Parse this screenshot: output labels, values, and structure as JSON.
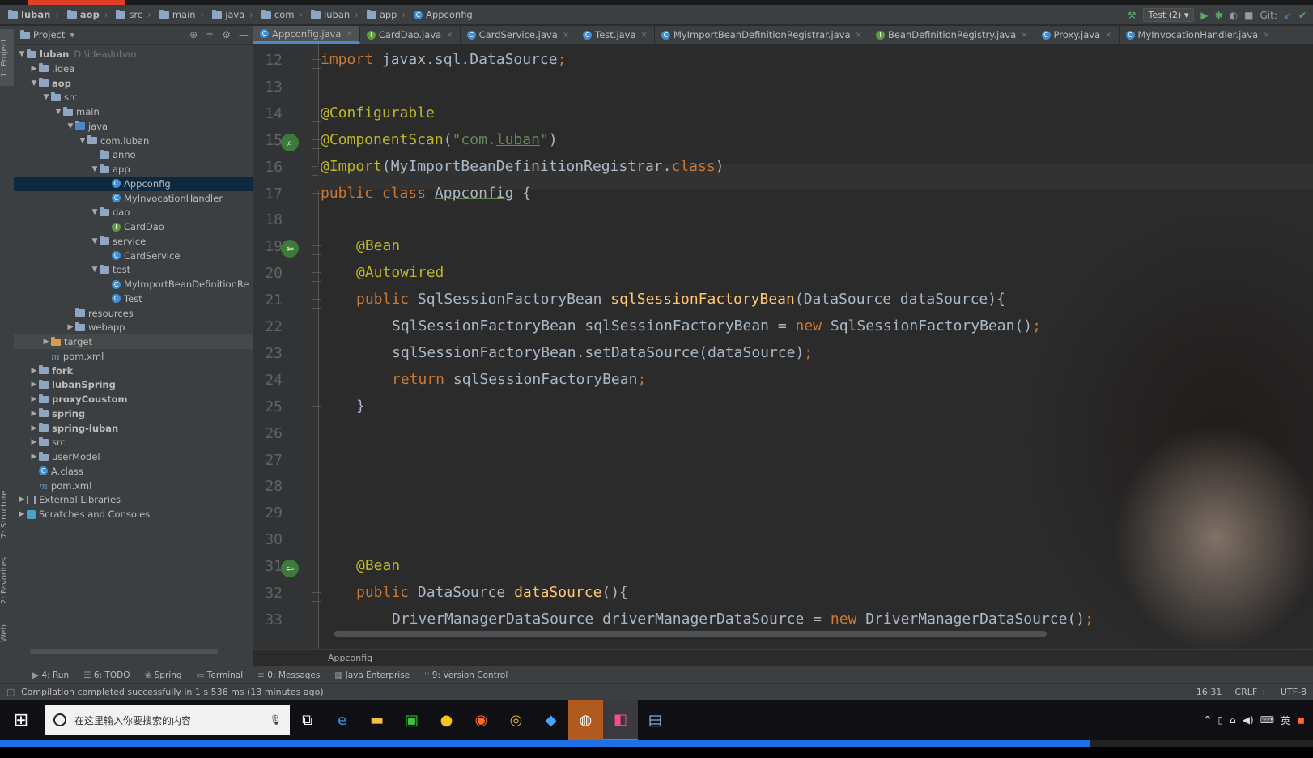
{
  "navbar": {
    "crumbs": [
      "luban",
      "aop",
      "src",
      "main",
      "java",
      "com",
      "luban",
      "app",
      "Appconfig"
    ],
    "run_config": "Test (2)",
    "vcs_label": "Git:"
  },
  "tool_windows_left": [
    "1: Project",
    "7: Structure",
    "2: Favorites",
    "Web"
  ],
  "project": {
    "header": "Project",
    "rows": [
      {
        "label": "luban",
        "path": "D:\\idea\\luban"
      },
      {
        "label": ".idea"
      },
      {
        "label": "aop"
      },
      {
        "label": "src"
      },
      {
        "label": "main"
      },
      {
        "label": "java"
      },
      {
        "label": "com.luban"
      },
      {
        "label": "anno"
      },
      {
        "label": "app"
      },
      {
        "label": "Appconfig"
      },
      {
        "label": "MyInvocationHandler"
      },
      {
        "label": "dao"
      },
      {
        "label": "CardDao"
      },
      {
        "label": "service"
      },
      {
        "label": "CardService"
      },
      {
        "label": "test"
      },
      {
        "label": "MyImportBeanDefinitionRe"
      },
      {
        "label": "Test"
      },
      {
        "label": "resources"
      },
      {
        "label": "webapp"
      },
      {
        "label": "target"
      },
      {
        "label": "pom.xml"
      },
      {
        "label": "fork"
      },
      {
        "label": "lubanSpring"
      },
      {
        "label": "proxyCoustom"
      },
      {
        "label": "spring"
      },
      {
        "label": "spring-luban"
      },
      {
        "label": "src"
      },
      {
        "label": "userModel"
      },
      {
        "label": "A.class"
      },
      {
        "label": "pom.xml"
      },
      {
        "label": "External Libraries"
      },
      {
        "label": "Scratches and Consoles"
      }
    ]
  },
  "tabs": [
    "Appconfig.java",
    "CardDao.java",
    "CardService.java",
    "Test.java",
    "MyImportBeanDefinitionRegistrar.java",
    "BeanDefinitionRegistry.java",
    "Proxy.java",
    "MyInvocationHandler.java"
  ],
  "editor": {
    "line_numbers": [
      "12",
      "13",
      "14",
      "15",
      "16",
      "17",
      "18",
      "19",
      "20",
      "21",
      "22",
      "23",
      "24",
      "25",
      "26",
      "27",
      "28",
      "29",
      "30",
      "31",
      "32",
      "33"
    ],
    "breadcrumb": "Appconfig",
    "code": {
      "l12a": "import",
      "l12b": " javax.sql.DataSource",
      "l12c": ";",
      "l14": "@Configurable",
      "l15a": "@ComponentScan",
      "l15b": "(",
      "l15c": "\"com.",
      "l15d": "luban",
      "l15e": "\"",
      "l15f": ")",
      "l16a": "@Import",
      "l16b": "(MyImportBeanDefinitionRegistrar.",
      "l16c": "class",
      "l16d": ")",
      "l17a": "public class ",
      "l17b": "Appconfig",
      "l17c": " {",
      "l19": "@Bean",
      "l20": "@Autowired",
      "l21a": "public ",
      "l21b": "SqlSessionFactoryBean ",
      "l21c": "sqlSessionFactoryBean",
      "l21d": "(DataSource dataSource){",
      "l22a": "SqlSessionFactoryBean sqlSessionFactoryBean = ",
      "l22b": "new ",
      "l22c": "SqlSessionFactoryBean()",
      "l22d": ";",
      "l23a": "sqlSessionFactoryBean.setDataSource(dataSource)",
      "l23b": ";",
      "l24a": "return ",
      "l24b": "sqlSessionFactoryBean",
      "l24c": ";",
      "l25": "}",
      "l31": "@Bean",
      "l32a": "public ",
      "l32b": "DataSource ",
      "l32c": "dataSource",
      "l32d": "(){",
      "l33a": "DriverManagerDataSource driverManagerDataSource = ",
      "l33b": "new ",
      "l33c": "DriverManagerDataSource()",
      "l33d": ";"
    }
  },
  "tool_strip": [
    "4: Run",
    "6: TODO",
    "Spring",
    "Terminal",
    "0: Messages",
    "Java Enterprise",
    "9: Version Control"
  ],
  "status": {
    "message": "Compilation completed successfully in 1 s 536 ms (13 minutes ago)",
    "position": "16:31",
    "line_sep": "CRLF",
    "encoding": "UTF-8"
  },
  "taskbar": {
    "search_placeholder": "在这里输入你要搜索的内容",
    "tray_lang": "英"
  },
  "video_progress": 0.83
}
